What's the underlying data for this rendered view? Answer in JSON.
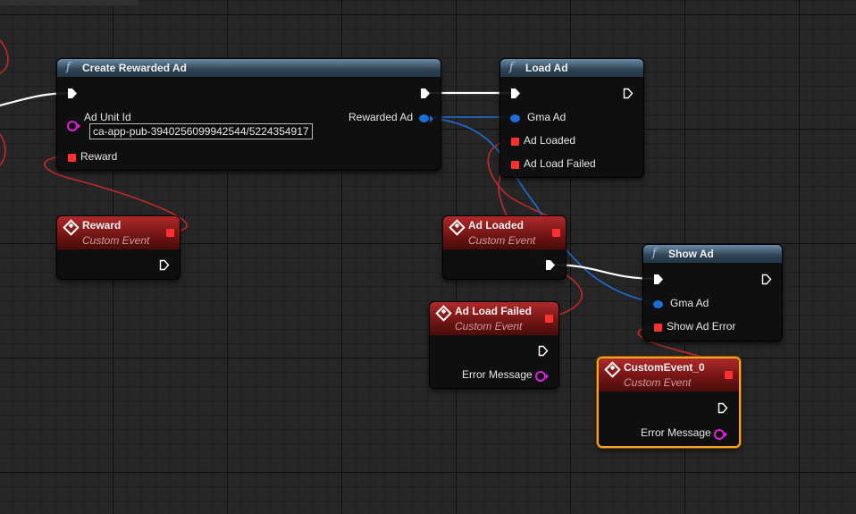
{
  "graph": {
    "nodes": {
      "create_rewarded_ad": {
        "title": "Create Rewarded Ad",
        "inputs": {
          "ad_unit_id_label": "Ad Unit Id",
          "ad_unit_id_value": "ca-app-pub-3940256099942544/5224354917",
          "reward_label": "Reward"
        },
        "outputs": {
          "rewarded_ad_label": "Rewarded Ad"
        }
      },
      "load_ad": {
        "title": "Load Ad",
        "inputs": {
          "gma_ad_label": "Gma Ad",
          "ad_loaded_label": "Ad Loaded",
          "ad_load_failed_label": "Ad Load Failed"
        }
      },
      "reward_event": {
        "title": "Reward",
        "subtitle": "Custom Event"
      },
      "ad_loaded_event": {
        "title": "Ad Loaded",
        "subtitle": "Custom Event"
      },
      "ad_load_failed_event": {
        "title": "Ad Load Failed",
        "subtitle": "Custom Event",
        "error_message_label": "Error Message"
      },
      "show_ad": {
        "title": "Show Ad",
        "inputs": {
          "gma_ad_label": "Gma Ad",
          "show_ad_error_label": "Show Ad Error"
        }
      },
      "custom_event_0": {
        "title": "CustomEvent_0",
        "subtitle": "Custom Event",
        "error_message_label": "Error Message",
        "selected": true
      }
    },
    "colors": {
      "exec_wire": "#ffffff",
      "object_wire": "#1f6ed8",
      "delegate_wire": "#d02a2a",
      "string_pin": "#e020e0",
      "selection": "#f5a623"
    },
    "icons": {
      "function": "function-f-icon",
      "event": "event-diamond-icon",
      "exec": "exec-arrow-icon"
    }
  }
}
